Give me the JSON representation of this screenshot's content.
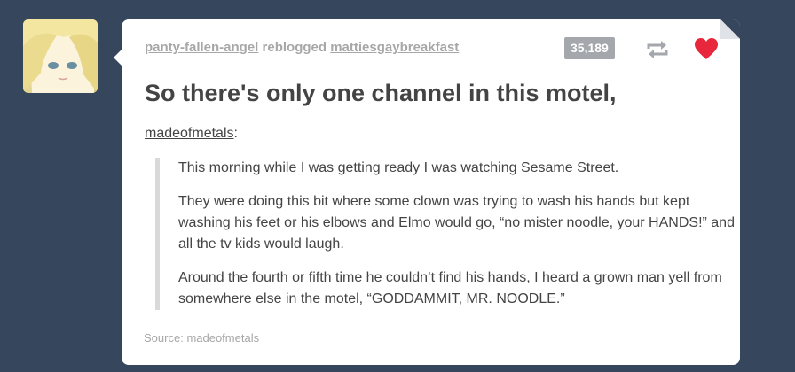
{
  "avatar": {
    "icon": "anime-girl-avatar"
  },
  "post": {
    "reblogger": "panty-fallen-angel",
    "reblogged_text": "reblogged",
    "original_poster": "mattiesgaybreakfast",
    "note_count": "35,189",
    "title": "So there's only one channel in this motel,",
    "quoted_user": "madeofmetals",
    "quoted_user_suffix": ":",
    "paragraphs": [
      "This morning while I was getting ready I was watching Sesame Street.",
      "They were doing this bit where some clown was trying to wash his hands but kept washing his feet or his elbows and Elmo would go, “no mister noodle, your HANDS!” and all the tv kids would laugh.",
      "Around the fourth or fifth time he couldn’t find his hands, I heard a grown man yell from somewhere else in the motel, “GODDAMMIT, MR. NOODLE.”"
    ],
    "source_label": "Source:",
    "source_user": "madeofmetals"
  },
  "colors": {
    "background": "#36465d",
    "card": "#ffffff",
    "like": "#e8273d",
    "muted": "#a7a7a7"
  }
}
